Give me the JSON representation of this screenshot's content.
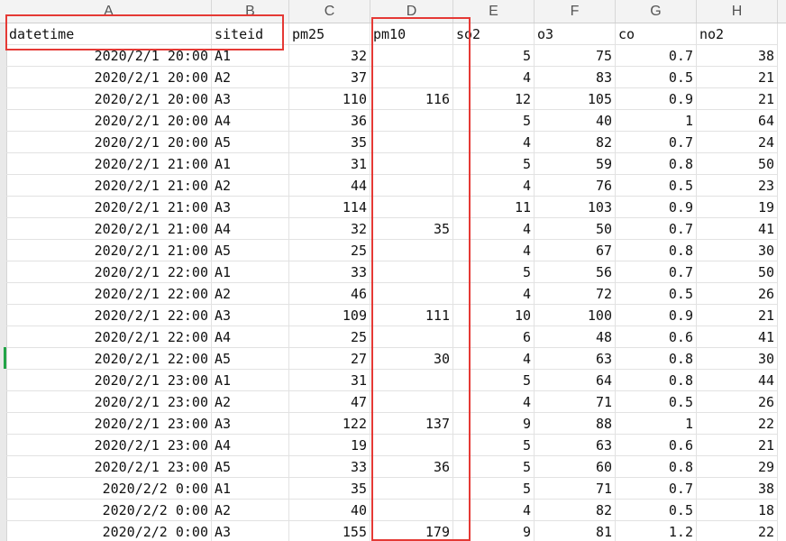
{
  "column_headers": [
    "A",
    "B",
    "C",
    "D",
    "E",
    "F",
    "G",
    "H"
  ],
  "header_row": [
    "datetime",
    "siteid",
    "pm25",
    "pm10",
    "so2",
    "o3",
    "co",
    "no2"
  ],
  "rows": [
    [
      "2020/2/1 20:00",
      "A1",
      "32",
      "",
      "5",
      "75",
      "0.7",
      "38"
    ],
    [
      "2020/2/1 20:00",
      "A2",
      "37",
      "",
      "4",
      "83",
      "0.5",
      "21"
    ],
    [
      "2020/2/1 20:00",
      "A3",
      "110",
      "116",
      "12",
      "105",
      "0.9",
      "21"
    ],
    [
      "2020/2/1 20:00",
      "A4",
      "36",
      "",
      "5",
      "40",
      "1",
      "64"
    ],
    [
      "2020/2/1 20:00",
      "A5",
      "35",
      "",
      "4",
      "82",
      "0.7",
      "24"
    ],
    [
      "2020/2/1 21:00",
      "A1",
      "31",
      "",
      "5",
      "59",
      "0.8",
      "50"
    ],
    [
      "2020/2/1 21:00",
      "A2",
      "44",
      "",
      "4",
      "76",
      "0.5",
      "23"
    ],
    [
      "2020/2/1 21:00",
      "A3",
      "114",
      "",
      "11",
      "103",
      "0.9",
      "19"
    ],
    [
      "2020/2/1 21:00",
      "A4",
      "32",
      "35",
      "4",
      "50",
      "0.7",
      "41"
    ],
    [
      "2020/2/1 21:00",
      "A5",
      "25",
      "",
      "4",
      "67",
      "0.8",
      "30"
    ],
    [
      "2020/2/1 22:00",
      "A1",
      "33",
      "",
      "5",
      "56",
      "0.7",
      "50"
    ],
    [
      "2020/2/1 22:00",
      "A2",
      "46",
      "",
      "4",
      "72",
      "0.5",
      "26"
    ],
    [
      "2020/2/1 22:00",
      "A3",
      "109",
      "111",
      "10",
      "100",
      "0.9",
      "21"
    ],
    [
      "2020/2/1 22:00",
      "A4",
      "25",
      "",
      "6",
      "48",
      "0.6",
      "41"
    ],
    [
      "2020/2/1 22:00",
      "A5",
      "27",
      "30",
      "4",
      "63",
      "0.8",
      "30"
    ],
    [
      "2020/2/1 23:00",
      "A1",
      "31",
      "",
      "5",
      "64",
      "0.8",
      "44"
    ],
    [
      "2020/2/1 23:00",
      "A2",
      "47",
      "",
      "4",
      "71",
      "0.5",
      "26"
    ],
    [
      "2020/2/1 23:00",
      "A3",
      "122",
      "137",
      "9",
      "88",
      "1",
      "22"
    ],
    [
      "2020/2/1 23:00",
      "A4",
      "19",
      "",
      "5",
      "63",
      "0.6",
      "21"
    ],
    [
      "2020/2/1 23:00",
      "A5",
      "33",
      "36",
      "5",
      "60",
      "0.8",
      "29"
    ],
    [
      "2020/2/2 0:00",
      "A1",
      "35",
      "",
      "5",
      "71",
      "0.7",
      "38"
    ],
    [
      "2020/2/2 0:00",
      "A2",
      "40",
      "",
      "4",
      "82",
      "0.5",
      "18"
    ],
    [
      "2020/2/2 0:00",
      "A3",
      "155",
      "179",
      "9",
      "81",
      "1.2",
      "22"
    ]
  ],
  "colors": {
    "highlight": "#e53935",
    "selection_marker": "#22a447"
  }
}
